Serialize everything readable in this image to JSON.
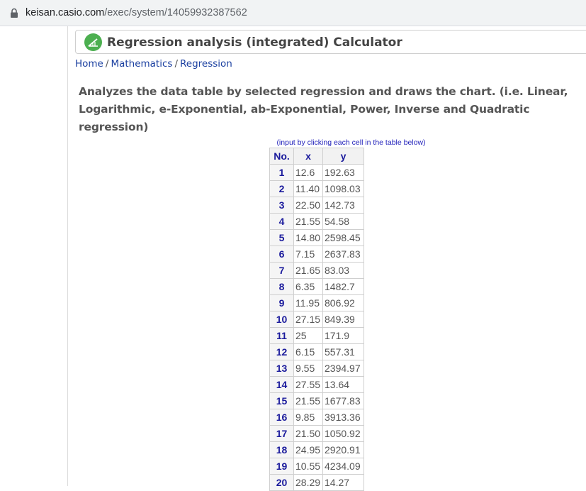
{
  "browser": {
    "url_host": "keisan.casio.com",
    "url_path": "/exec/system/14059932387562"
  },
  "page": {
    "title": "Regression analysis (integrated) Calculator",
    "breadcrumb": [
      "Home",
      "Mathematics",
      "Regression"
    ],
    "breadcrumb_separator": "/",
    "description": "Analyzes the data table by selected regression and draws the chart. (i.e. Linear, Logarithmic, e-Exponential, ab-Exponential, Power, Inverse and Quadratic regression)",
    "table_hint": "(input by clicking each cell in the table below)"
  },
  "table": {
    "headers": [
      "No.",
      "x",
      "y"
    ],
    "rows": [
      {
        "no": "1",
        "x": "12.6",
        "y": "192.63"
      },
      {
        "no": "2",
        "x": "11.40",
        "y": "1098.03"
      },
      {
        "no": "3",
        "x": "22.50",
        "y": "142.73"
      },
      {
        "no": "4",
        "x": "21.55",
        "y": "54.58"
      },
      {
        "no": "5",
        "x": "14.80",
        "y": "2598.45"
      },
      {
        "no": "6",
        "x": "7.15",
        "y": "2637.83"
      },
      {
        "no": "7",
        "x": "21.65",
        "y": "83.03"
      },
      {
        "no": "8",
        "x": "6.35",
        "y": "1482.7"
      },
      {
        "no": "9",
        "x": "11.95",
        "y": "806.92"
      },
      {
        "no": "10",
        "x": "27.15",
        "y": "849.39"
      },
      {
        "no": "11",
        "x": "25",
        "y": "171.9"
      },
      {
        "no": "12",
        "x": "6.15",
        "y": "557.31"
      },
      {
        "no": "13",
        "x": "9.55",
        "y": "2394.97"
      },
      {
        "no": "14",
        "x": "27.55",
        "y": "13.64"
      },
      {
        "no": "15",
        "x": "21.55",
        "y": "1677.83"
      },
      {
        "no": "16",
        "x": "9.85",
        "y": "3913.36"
      },
      {
        "no": "17",
        "x": "21.50",
        "y": "1050.92"
      },
      {
        "no": "18",
        "x": "24.95",
        "y": "2920.91"
      },
      {
        "no": "19",
        "x": "10.55",
        "y": "4234.09"
      },
      {
        "no": "20",
        "x": "28.29",
        "y": "14.27"
      }
    ]
  },
  "icons": {
    "address_bar": "lock-icon",
    "title": "regression-chart-logo-icon"
  },
  "colors": {
    "link": "#1a3fa0",
    "header_text": "#1a1a9c",
    "logo_green": "#4caf50"
  }
}
